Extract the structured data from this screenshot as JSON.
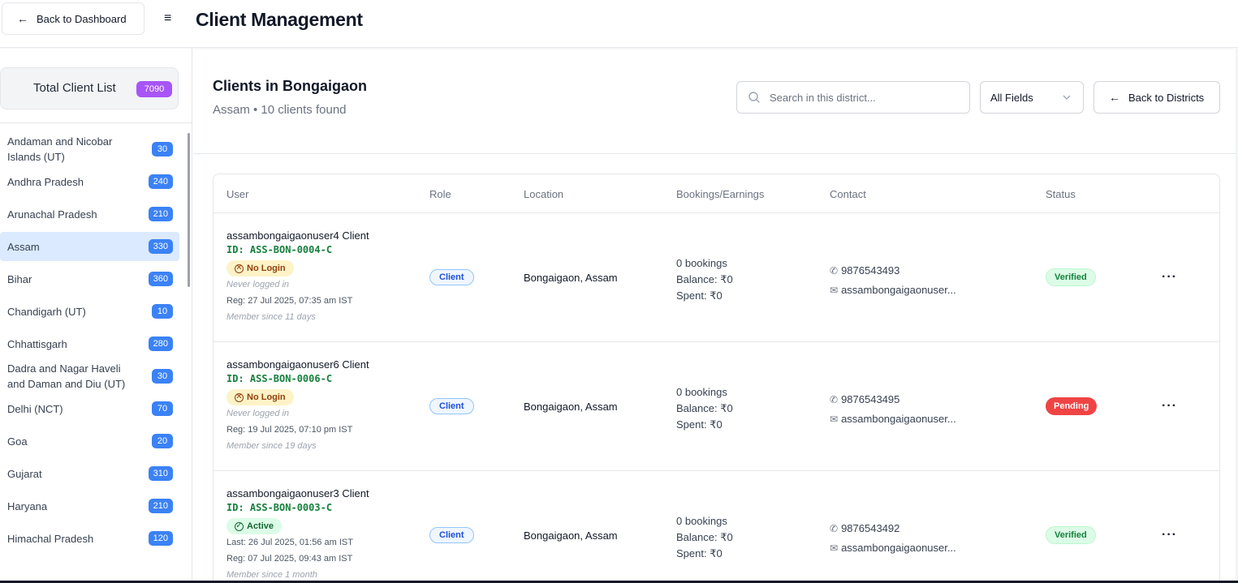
{
  "header": {
    "back_label": "Back to Dashboard",
    "title": "Client Management"
  },
  "sidebar": {
    "total_label": "Total Client List",
    "total_count": "7090",
    "states": [
      {
        "name": "Andaman and Nicobar Islands (UT)",
        "count": "30"
      },
      {
        "name": "Andhra Pradesh",
        "count": "240"
      },
      {
        "name": "Arunachal Pradesh",
        "count": "210"
      },
      {
        "name": "Assam",
        "count": "330",
        "active": true
      },
      {
        "name": "Bihar",
        "count": "360"
      },
      {
        "name": "Chandigarh (UT)",
        "count": "10"
      },
      {
        "name": "Chhattisgarh",
        "count": "280"
      },
      {
        "name": "Dadra and Nagar Haveli and Daman and Diu (UT)",
        "count": "30"
      },
      {
        "name": "Delhi (NCT)",
        "count": "70"
      },
      {
        "name": "Goa",
        "count": "20"
      },
      {
        "name": "Gujarat",
        "count": "310"
      },
      {
        "name": "Haryana",
        "count": "210"
      },
      {
        "name": "Himachal Pradesh",
        "count": "120"
      }
    ]
  },
  "main": {
    "title": "Clients in Bongaigaon",
    "subtitle": "Assam • 10 clients found",
    "search_placeholder": "Search in this district...",
    "field_select": "All Fields",
    "back_districts_label": "Back to Districts",
    "columns": [
      "User",
      "Role",
      "Location",
      "Bookings/Earnings",
      "Contact",
      "Status"
    ],
    "rows": [
      {
        "name": "assambongaigaonuser4 Client",
        "id": "ID: ASS-BON-0004-C",
        "login": "No Login",
        "login_state": "nologin",
        "last": "Never logged in",
        "reg": "Reg: 27 Jul 2025, 07:35 am IST",
        "member": "Member since 11 days",
        "role": "Client",
        "location": "Bongaigaon, Assam",
        "bookings": "0 bookings",
        "balance": "Balance: ₹0",
        "spent": "Spent: ₹0",
        "phone": "9876543493",
        "email": "assambongaigaonuser...",
        "status": "Verified",
        "status_state": "verified"
      },
      {
        "name": "assambongaigaonuser6 Client",
        "id": "ID: ASS-BON-0006-C",
        "login": "No Login",
        "login_state": "nologin",
        "last": "Never logged in",
        "reg": "Reg: 19 Jul 2025, 07:10 pm IST",
        "member": "Member since 19 days",
        "role": "Client",
        "location": "Bongaigaon, Assam",
        "bookings": "0 bookings",
        "balance": "Balance: ₹0",
        "spent": "Spent: ₹0",
        "phone": "9876543495",
        "email": "assambongaigaonuser...",
        "status": "Pending",
        "status_state": "pending"
      },
      {
        "name": "assambongaigaonuser3 Client",
        "id": "ID: ASS-BON-0003-C",
        "login": "Active",
        "login_state": "active",
        "last": "Last: 26 Jul 2025, 01:56 am IST",
        "reg": "Reg: 07 Jul 2025, 09:43 am IST",
        "member": "Member since 1 month",
        "role": "Client",
        "location": "Bongaigaon, Assam",
        "bookings": "0 bookings",
        "balance": "Balance: ₹0",
        "spent": "Spent: ₹0",
        "phone": "9876543492",
        "email": "assambongaigaonuser...",
        "status": "Verified",
        "status_state": "verified"
      }
    ]
  }
}
